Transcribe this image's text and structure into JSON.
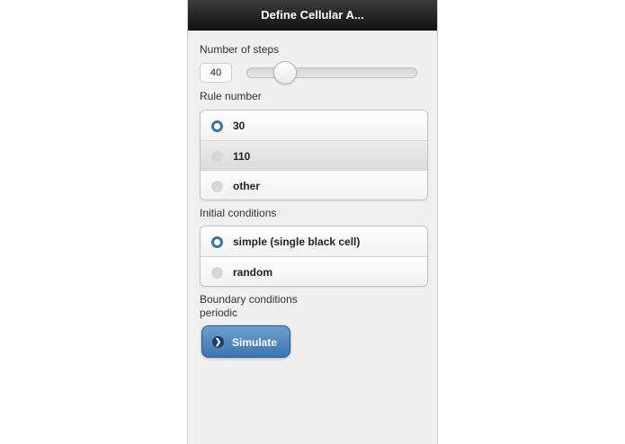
{
  "header": {
    "title": "Define Cellular A..."
  },
  "steps": {
    "label": "Number of steps",
    "value": "40",
    "slider_fraction": 0.18
  },
  "rule": {
    "label": "Rule number",
    "options": [
      {
        "label": "30",
        "selected": true
      },
      {
        "label": "110",
        "selected": false
      },
      {
        "label": "other",
        "selected": false
      }
    ]
  },
  "initial": {
    "label": "Initial conditions",
    "options": [
      {
        "label": "simple (single black cell)",
        "selected": true
      },
      {
        "label": "random",
        "selected": false
      }
    ]
  },
  "boundary": {
    "label": "Boundary conditions",
    "value": "periodic"
  },
  "simulate": {
    "label": "Simulate",
    "icon": "chevron-right-icon"
  },
  "colors": {
    "accent": "#3a74ad",
    "header": "#1a1a1a"
  }
}
